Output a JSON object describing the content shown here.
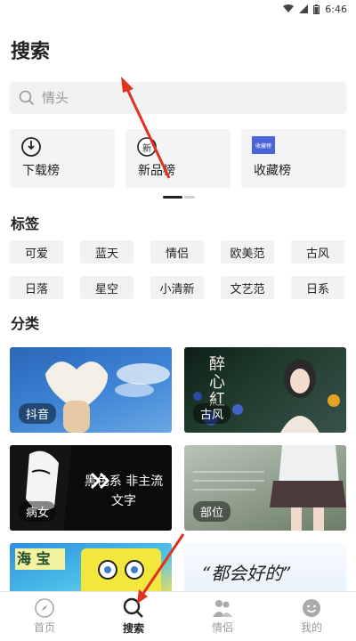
{
  "status": {
    "time": "6:46"
  },
  "page": {
    "title": "搜索"
  },
  "search": {
    "placeholder": "情头"
  },
  "rankings": [
    {
      "label": "下载榜",
      "icon": "clock-download-icon"
    },
    {
      "label": "新品榜",
      "icon": "new-badge-icon",
      "icon_text": "新"
    },
    {
      "label": "收藏榜",
      "icon": "collection-thumb-icon",
      "icon_text": "收藏榜"
    }
  ],
  "tags": {
    "title": "标签",
    "items": [
      "可爱",
      "蓝天",
      "情侣",
      "欧美范",
      "古风",
      "日落",
      "星空",
      "小清新",
      "文艺范",
      "日系"
    ]
  },
  "categories": {
    "title": "分类",
    "items": [
      {
        "label": "抖音",
        "overlay": ""
      },
      {
        "label": "古风",
        "overlay": "醉心紅"
      },
      {
        "label": "病女",
        "overlay": "黑色系 非主流文字"
      },
      {
        "label": "部位",
        "overlay": ""
      },
      {
        "label": "",
        "overlay": "海 宝"
      },
      {
        "label": "",
        "overlay": "“都会好的”"
      }
    ]
  },
  "tabbar": {
    "items": [
      {
        "label": "首页",
        "icon": "compass-icon",
        "active": false
      },
      {
        "label": "搜索",
        "icon": "search-icon",
        "active": true
      },
      {
        "label": "情侣",
        "icon": "couple-icon",
        "active": false
      },
      {
        "label": "我的",
        "icon": "smiley-icon",
        "active": false
      }
    ]
  },
  "colors": {
    "accent": "#222222",
    "annotation_arrow": "#e0301e",
    "tag_bg": "#f2f2f2"
  }
}
